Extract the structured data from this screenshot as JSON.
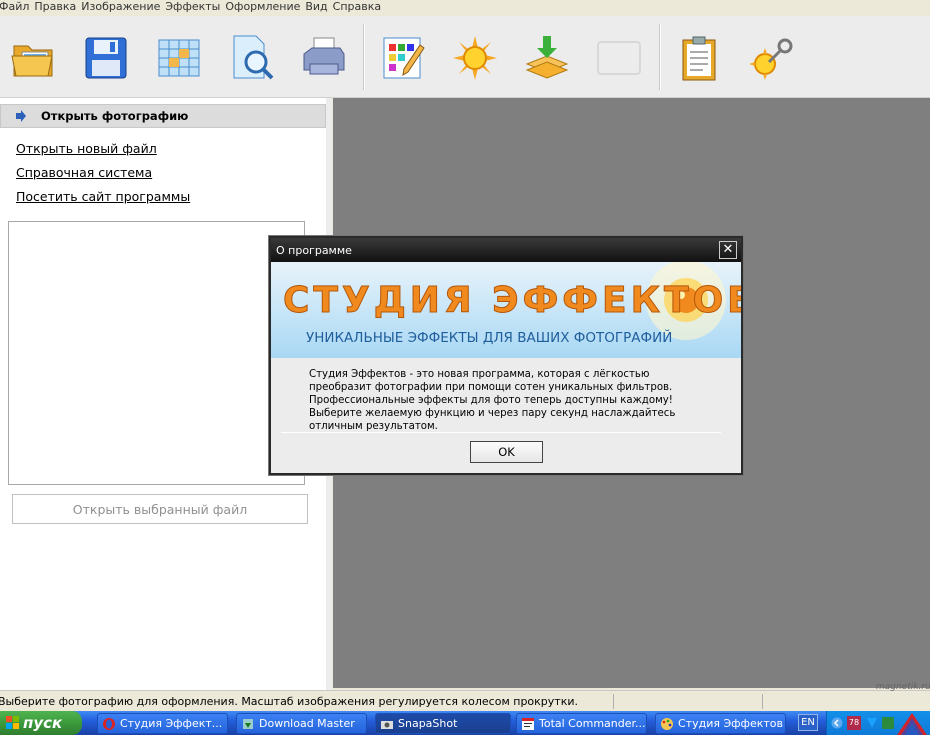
{
  "menu": [
    "Файл",
    "Правка",
    "Изображение",
    "Эффекты",
    "Оформление",
    "Вид",
    "Справка"
  ],
  "toolbar_icons": [
    "open-folder-icon",
    "save-disk-icon",
    "grid-icon",
    "preview-magnifier-icon",
    "printer-icon",
    "palette-edit-icon",
    "sun-effects-icon",
    "download-layers-icon",
    "empty-frame-icon",
    "clipboard-icon",
    "key-sun-icon"
  ],
  "left_panel": {
    "header": "Открыть фотографию",
    "links": [
      "Открыть новый файл",
      "Справочная система",
      "Посетить сайт программы"
    ],
    "open_button": "Открыть выбранный файл"
  },
  "status": {
    "text": "Выберите фотографию для оформления. Масштаб изображения регулируется колесом прокрутки."
  },
  "dialog": {
    "title": "О программе",
    "close": "✕",
    "banner_title": "СТУДИЯ ЭФФЕКТОВ",
    "banner_subtitle": "УНИКАЛЬНЫЕ ЭФФЕКТЫ ДЛЯ ВАШИХ ФОТОГРАФИЙ",
    "body": "Студия Эффектов - это новая программа, которая с лёгкостью преобразит фотографии при помощи сотен уникальных фильтров. Профессиональные эффекты для фото теперь доступны каждому! Выберите желаемую функцию и через пару секунд наслаждайтесь отличным результатом.",
    "ok": "OK"
  },
  "taskbar": {
    "start": "пуск",
    "tasks": [
      "Студия Эффект...",
      "Download Master",
      "SnapaShot",
      "Total Commander...",
      "Студия Эффектов"
    ],
    "lang": "EN",
    "tray_badge": "78"
  },
  "watermark": "magnetik.ru",
  "colors": {
    "canvas": "#7f7f7f",
    "dialog_titlebar": "#1a1a1a",
    "banner_orange": "#f08a1e",
    "taskbar_blue": "#245edb",
    "start_green": "#3c9a3c"
  }
}
